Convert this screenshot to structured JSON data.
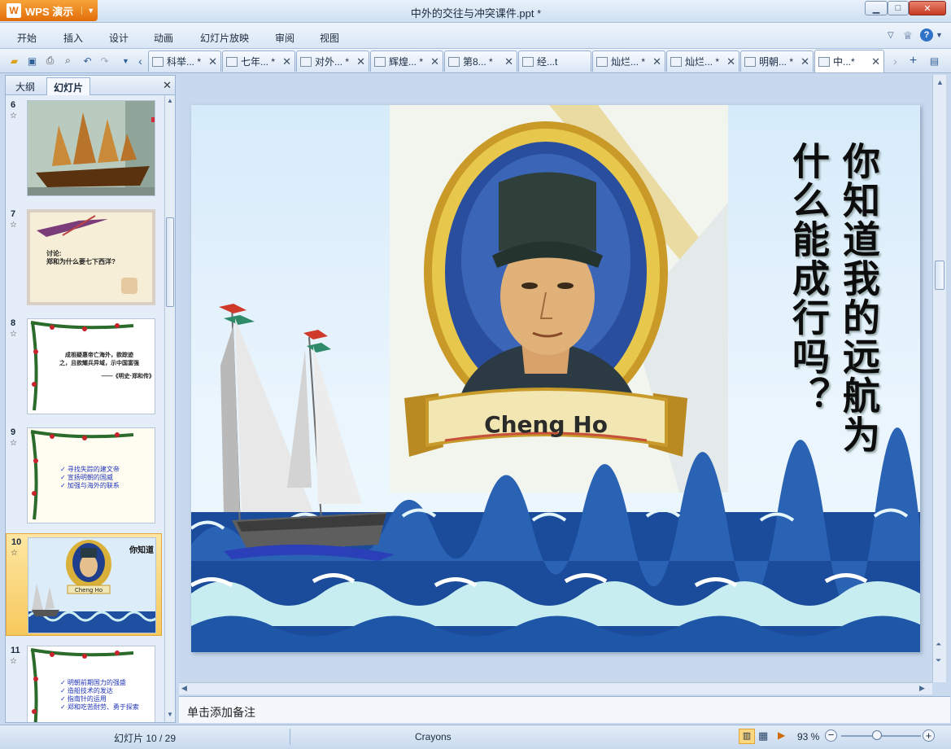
{
  "app": {
    "name": "WPS 演示",
    "document_title": "中外的交往与冲突课件.ppt *"
  },
  "window_controls": {
    "minimize": "▁",
    "maximize": "□",
    "close": "✕"
  },
  "menu": [
    "开始",
    "插入",
    "设计",
    "动画",
    "幻灯片放映",
    "审阅",
    "视图"
  ],
  "tabs": [
    {
      "label": "科举...",
      "modified": "*"
    },
    {
      "label": "七年...",
      "modified": "*"
    },
    {
      "label": "对外...",
      "modified": "*"
    },
    {
      "label": "辉煌...",
      "modified": "*"
    },
    {
      "label": "第8...",
      "modified": "*"
    },
    {
      "label": "经...t",
      "modified": ""
    },
    {
      "label": "灿烂...",
      "modified": "*"
    },
    {
      "label": "灿烂...",
      "modified": "*"
    },
    {
      "label": "明朝...",
      "modified": "*"
    },
    {
      "label": "中...",
      "modified": "*"
    }
  ],
  "panel": {
    "tabs": [
      "大纲",
      "幻灯片"
    ],
    "active_tab": "幻灯片",
    "close": "✕"
  },
  "thumbnails": [
    {
      "number": "6",
      "star": "☆"
    },
    {
      "number": "7",
      "star": "☆",
      "lines": [
        "讨论:",
        "郑和为什么要七下西洋?"
      ]
    },
    {
      "number": "8",
      "star": "☆",
      "lines": [
        "成祖疑惠帝亡海外，欲踪迹",
        "之，且欲耀兵异域，示中国富强",
        "——《明史·郑和传》"
      ]
    },
    {
      "number": "9",
      "star": "☆",
      "lines": [
        "✓ 寻找失踪的建文帝",
        "✓ 宣扬明朝的国威",
        "✓ 加强与海外的联系"
      ]
    },
    {
      "number": "10",
      "star": "☆",
      "selected": true
    },
    {
      "number": "11",
      "star": "☆",
      "lines": [
        "✓ 明朝前期国力的强盛",
        "✓ 造船技术的发达",
        "✓ 指南针的运用",
        "✓ 郑和吃苦耐劳、勇于探索"
      ]
    }
  ],
  "slide": {
    "portrait_caption": "Cheng Ho",
    "vertical_text": [
      "你知道我的远航为",
      "什么能成行吗？"
    ]
  },
  "notes_placeholder": "单击添加备注",
  "status": {
    "slide_indicator": "幻灯片 10 / 29",
    "theme": "Crayons",
    "zoom": "93 %"
  },
  "colors": {
    "accent": "#e8760f",
    "sea": "#1e4fa0",
    "frame_gold": "#d9b13a"
  }
}
